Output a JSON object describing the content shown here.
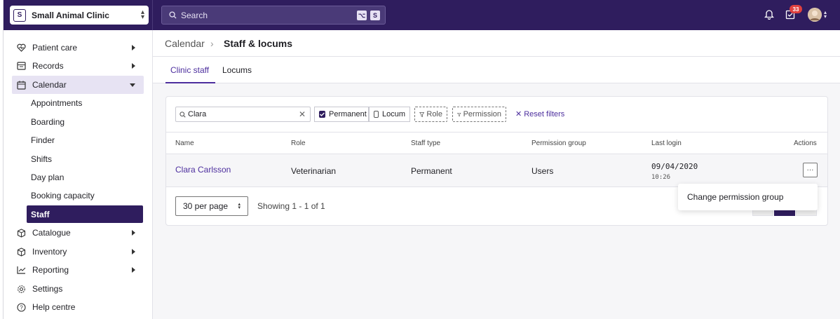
{
  "org": {
    "initial": "S",
    "name": "Small Animal Clinic"
  },
  "search": {
    "placeholder": "Search",
    "kbd1": "⌥",
    "kbd2": "S"
  },
  "notifications": {
    "badge_count": "33"
  },
  "sidebar": {
    "items": [
      {
        "label": "Patient care",
        "icon": "heart-icon"
      },
      {
        "label": "Records",
        "icon": "folder-icon"
      },
      {
        "label": "Calendar",
        "icon": "calendar-icon"
      },
      {
        "label": "Catalogue",
        "icon": "box-icon"
      },
      {
        "label": "Inventory",
        "icon": "box-icon"
      },
      {
        "label": "Reporting",
        "icon": "chart-icon"
      },
      {
        "label": "Settings",
        "icon": "gear-icon"
      },
      {
        "label": "Help centre",
        "icon": "help-icon"
      }
    ],
    "calendar_sub": [
      "Appointments",
      "Boarding",
      "Finder",
      "Shifts",
      "Day plan",
      "Booking capacity",
      "Staff"
    ]
  },
  "breadcrumb": {
    "parent": "Calendar",
    "current": "Staff & locums"
  },
  "tabs": [
    "Clinic staff",
    "Locums"
  ],
  "filters": {
    "search_value": "Clara",
    "permanent": "Permanent",
    "locum": "Locum",
    "role": "Role",
    "permission": "Permission",
    "reset": "Reset filters"
  },
  "table": {
    "headers": [
      "Name",
      "Role",
      "Staff type",
      "Permission group",
      "Last login",
      "Actions"
    ],
    "rows": [
      {
        "name": "Clara Carlsson",
        "role": "Veterinarian",
        "staff_type": "Permanent",
        "permission_group": "Users",
        "last_login_date": "09/04/2020",
        "last_login_time": "10:26"
      }
    ]
  },
  "pagination": {
    "per_page": "30 per page",
    "showing": "Showing 1 - 1 of 1"
  },
  "actions_menu": {
    "item": "Change permission group"
  },
  "colors": {
    "brand": "#2f1d5e",
    "accent": "#4d2f9e",
    "badge": "#e0413f"
  }
}
